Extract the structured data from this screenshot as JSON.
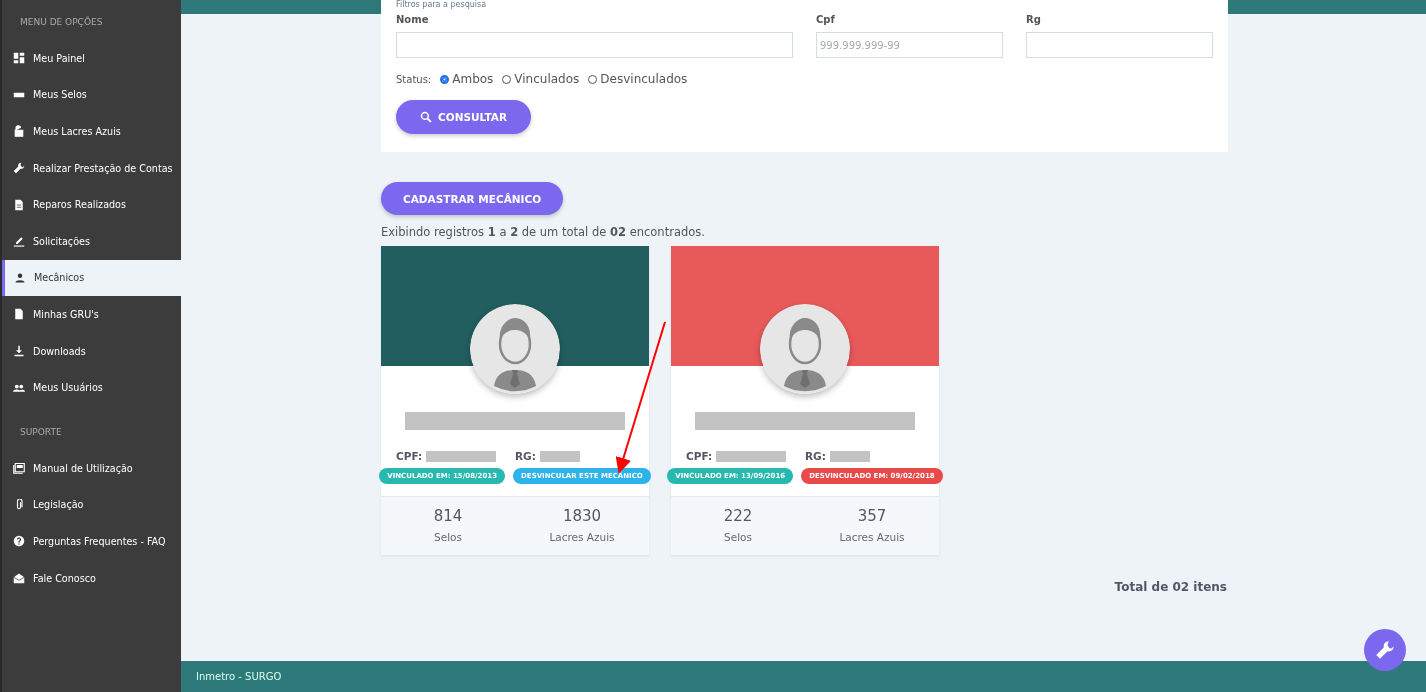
{
  "sidebar": {
    "sections": [
      {
        "title": "MENU DE OPÇÕES",
        "items": [
          {
            "label": "Meu Painel",
            "selected": false
          },
          {
            "label": "Meus Selos",
            "selected": false
          },
          {
            "label": "Meus Lacres Azuis",
            "selected": false
          },
          {
            "label": "Realizar Prestação de Contas",
            "selected": false
          },
          {
            "label": "Reparos Realizados",
            "selected": false
          },
          {
            "label": "Solicitações",
            "selected": false
          },
          {
            "label": "Mecânicos",
            "selected": true
          },
          {
            "label": "Minhas GRU's",
            "selected": false
          },
          {
            "label": "Downloads",
            "selected": false
          },
          {
            "label": "Meus Usuários",
            "selected": false
          }
        ]
      },
      {
        "title": "SUPORTE",
        "items": [
          {
            "label": "Manual de Utilização",
            "selected": false
          },
          {
            "label": "Legislação",
            "selected": false
          },
          {
            "label": "Perguntas Frequentes - FAQ",
            "selected": false
          },
          {
            "label": "Fale Conosco",
            "selected": false
          }
        ]
      }
    ]
  },
  "filters": {
    "title": "Filtros para a pesquisa",
    "fields": [
      {
        "label": "Nome"
      },
      {
        "label": "Cpf",
        "placeholder": "999.999.999-99"
      },
      {
        "label": "Rg"
      }
    ],
    "status_label": "Status:",
    "status_options": [
      {
        "label": "Ambos",
        "selected": true
      },
      {
        "label": "Vinculados",
        "selected": false
      },
      {
        "label": "Desvinculados",
        "selected": false
      }
    ],
    "search_button": "CONSULTAR"
  },
  "add_button": "CADASTRAR MECÂNICO",
  "summary": "Exibindo registros **1** a **2** de um total de **02** encontrados.",
  "mechanics": [
    {
      "kind": "linked",
      "cpf_label": "CPF:",
      "rg_label": "RG:",
      "badges": [
        {
          "kind": "linked",
          "text": "VINCULADO EM: 15/08/2013"
        },
        {
          "kind": "action",
          "text": "DESVINCULAR ESTE MECÂNICO"
        }
      ],
      "stats": [
        {
          "value": "814",
          "label": "Selos"
        },
        {
          "value": "1830",
          "label": "Lacres Azuis"
        }
      ]
    },
    {
      "kind": "unlinked",
      "cpf_label": "CPF:",
      "rg_label": "RG:",
      "badges": [
        {
          "kind": "linked",
          "text": "VINCULADO EM: 13/09/2016"
        },
        {
          "kind": "unlinked",
          "text": "DESVINCULADO EM: 09/02/2018"
        }
      ],
      "stats": [
        {
          "value": "222",
          "label": "Selos"
        },
        {
          "value": "357",
          "label": "Lacres Azuis"
        }
      ]
    }
  ],
  "total": "Total de 02 itens",
  "footer": "Inmetro - SURGO"
}
